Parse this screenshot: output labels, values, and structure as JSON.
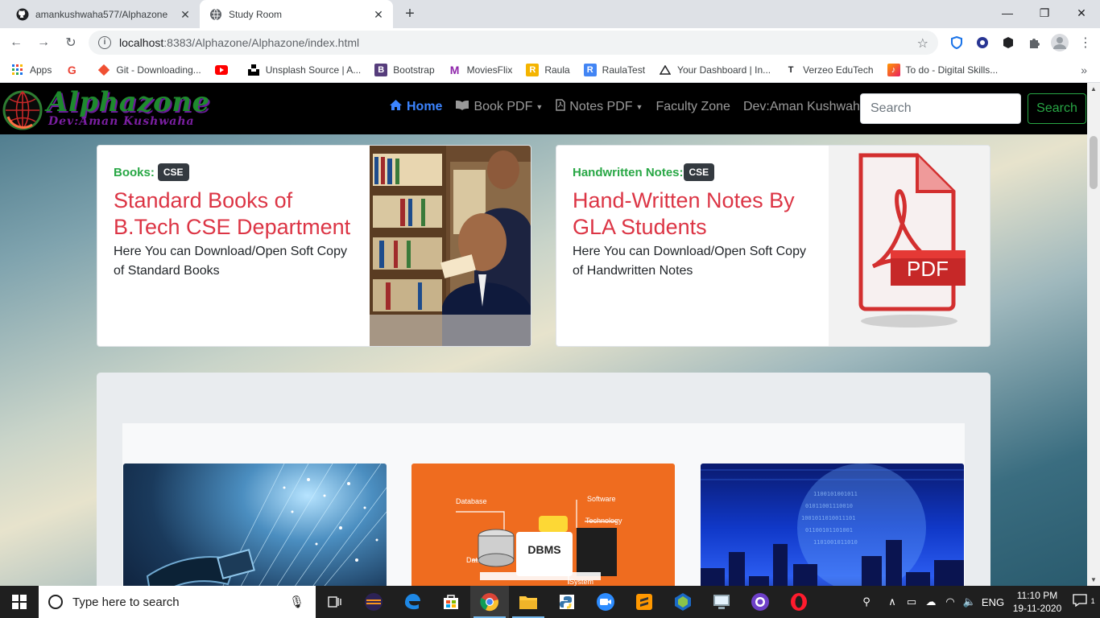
{
  "browser": {
    "tabs": [
      {
        "title": "amankushwaha577/Alphazone",
        "icon": "github-icon"
      },
      {
        "title": "Study Room",
        "icon": "globe-icon"
      }
    ],
    "address": {
      "host": "localhost",
      "path": ":8383/Alphazone/Alphazone/index.html"
    },
    "bookmarks": [
      {
        "label": "Apps",
        "icon": "apps-grid-icon",
        "color": "#1a73e8"
      },
      {
        "label": "",
        "icon": "google-icon",
        "color": "#ea4335"
      },
      {
        "label": "Git - Downloading...",
        "icon": "git-icon",
        "color": "#f05033"
      },
      {
        "label": "",
        "icon": "youtube-icon",
        "color": "#ff0000"
      },
      {
        "label": "Unsplash Source | A...",
        "icon": "unsplash-icon",
        "color": "#000000"
      },
      {
        "label": "Bootstrap",
        "icon": "bootstrap-icon",
        "color": "#563d7c"
      },
      {
        "label": "MoviesFlix",
        "icon": "moviesflix-icon",
        "color": "#8e24aa"
      },
      {
        "label": "Raula",
        "icon": "raula-icon",
        "color": "#f4b400"
      },
      {
        "label": "RaulaTest",
        "icon": "raulatest-icon",
        "color": "#4285f4"
      },
      {
        "label": "Your Dashboard | In...",
        "icon": "dashboard-icon",
        "color": "#202124"
      },
      {
        "label": "Verzeo EduTech",
        "icon": "verzeo-icon",
        "color": "#202124"
      },
      {
        "label": "To do - Digital Skills...",
        "icon": "todo-icon",
        "color": "#e91e63"
      }
    ]
  },
  "site": {
    "brand": "Alphazone",
    "brand_sub": "Dev:Aman Kushwaha",
    "nav": [
      {
        "label": "Home",
        "icon": "home-icon",
        "active": true
      },
      {
        "label": "Book PDF",
        "icon": "book-icon",
        "dropdown": true
      },
      {
        "label": "Notes PDF",
        "icon": "pdf-file-icon",
        "dropdown": true
      },
      {
        "label": "Faculty Zone"
      },
      {
        "label": "Dev:Aman Kushwaha"
      }
    ],
    "search": {
      "placeholder": "Search",
      "button": "Search"
    },
    "cards": [
      {
        "kicker": "Books:",
        "badge": "CSE",
        "title": "Standard Books of B.Tech CSE Department",
        "text": "Here You can Download/Open Soft Copy of Standard Books",
        "image": "students-with-books-photo"
      },
      {
        "kicker": "Handwritten Notes:",
        "badge": "CSE",
        "title": "Hand-Written Notes By GLA Students",
        "text": "Here You can Download/Open Soft Copy of Handwritten Notes",
        "image": "pdf-document-icon",
        "image_text": "PDF"
      }
    ],
    "thumbnails": [
      {
        "name": "networking-fiber-photo"
      },
      {
        "name": "dbms-diagram",
        "labels": [
          "Database",
          "Software",
          "Technology",
          "Data",
          "DBMS",
          "System"
        ]
      },
      {
        "name": "digital-city-photo"
      }
    ]
  },
  "taskbar": {
    "search_placeholder": "Type here to search",
    "language": "ENG",
    "time": "11:10 PM",
    "date": "19-11-2020",
    "notifications": "1"
  }
}
